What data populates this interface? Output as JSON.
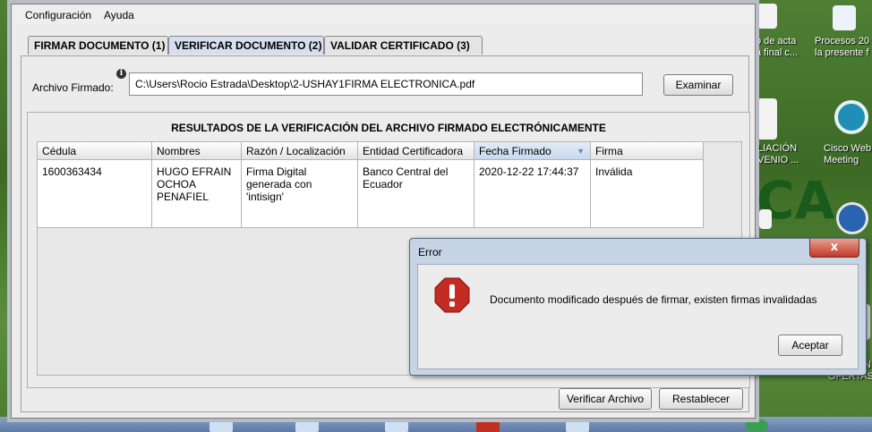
{
  "desktop": {
    "icons": [
      {
        "id": "acta",
        "line1": "o de acta",
        "line2": "a final c..."
      },
      {
        "id": "procesos",
        "line1": "Procesos 20",
        "line2": "la presente f"
      },
      {
        "id": "liacion",
        "line1": "LIACIÓN",
        "line2": "VENIO ..."
      },
      {
        "id": "cisco",
        "line1": "Cisco Web",
        "line2": "Meeting"
      },
      {
        "id": "ofertas",
        "line1": "ON",
        "line2": "OFERTAS"
      }
    ]
  },
  "app": {
    "menu": {
      "configuracion": "Configuración",
      "ayuda": "Ayuda"
    },
    "tabs": [
      {
        "label": "FIRMAR DOCUMENTO (1)"
      },
      {
        "label": "VERIFICAR DOCUMENTO (2)"
      },
      {
        "label": "VALIDAR CERTIFICADO (3)"
      }
    ],
    "archivo": {
      "label": "Archivo Firmado:",
      "value": "C:\\Users\\Rocio Estrada\\Desktop\\2-USHAY1FIRMA ELECTRONICA.pdf",
      "browse_button": "Examinar"
    },
    "results": {
      "title": "RESULTADOS DE LA VERIFICACIÓN DEL ARCHIVO FIRMADO ELECTRÓNICAMENTE",
      "columns": [
        "Cédula",
        "Nombres",
        "Razón / Localización",
        "Entidad Certificadora",
        "Fecha Firmado",
        "Firma"
      ],
      "row": {
        "cedula": "1600363434",
        "nombres_1": "HUGO EFRAIN",
        "nombres_2": "OCHOA PENAFIEL",
        "razon_1": "Firma Digital",
        "razon_2": "generada con",
        "razon_3": "'intisign'",
        "entidad_1": "Banco Central del",
        "entidad_2": "Ecuador",
        "fecha": "2020-12-22 17:44:37",
        "firma": "Inválida"
      }
    },
    "buttons": {
      "verificar": "Verificar Archivo",
      "restablecer": "Restablecer"
    }
  },
  "dialog": {
    "title": "Error",
    "close": "x",
    "message": "Documento modificado después de firmar, existen firmas invalidadas",
    "ok_button": "Aceptar"
  }
}
